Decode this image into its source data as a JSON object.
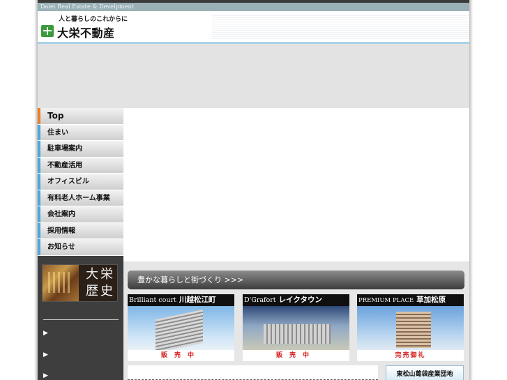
{
  "header": {
    "company_en": "Daiei Real Estate & Develpment",
    "tagline": "人と暮らしのこれからに",
    "company_name": "大栄不動産"
  },
  "nav": {
    "items": [
      {
        "label": "Top",
        "active": true
      },
      {
        "label": "住まい"
      },
      {
        "label": "駐車場案内"
      },
      {
        "label": "不動産活用"
      },
      {
        "label": "オフィスビル"
      },
      {
        "label": "有料老人ホーム事業"
      },
      {
        "label": "会社案内"
      },
      {
        "label": "採用情報"
      },
      {
        "label": "お知らせ"
      }
    ]
  },
  "history_banner": {
    "text": "大栄歴史"
  },
  "side_links": [
    "▶",
    "▶",
    "▶"
  ],
  "catchcopy": "豊かな暮らしと街づくり >>>",
  "properties": [
    {
      "name_en": "Brilliant court",
      "name_jp": "川越松江町",
      "status": "販売中"
    },
    {
      "name_en": "D'Grafort",
      "name_jp": "レイクタウン",
      "status": "販売中"
    },
    {
      "name_en": "PREMIUM PLACE",
      "name_jp": "草加松原",
      "status": "完売御礼"
    }
  ],
  "kanto_button": "東松山葛袋産業団地",
  "colors": {
    "accent_blue": "#4fa7da",
    "active_orange": "#e8802a",
    "status_red": "#d62020",
    "logo_green": "#3a9a3c"
  }
}
